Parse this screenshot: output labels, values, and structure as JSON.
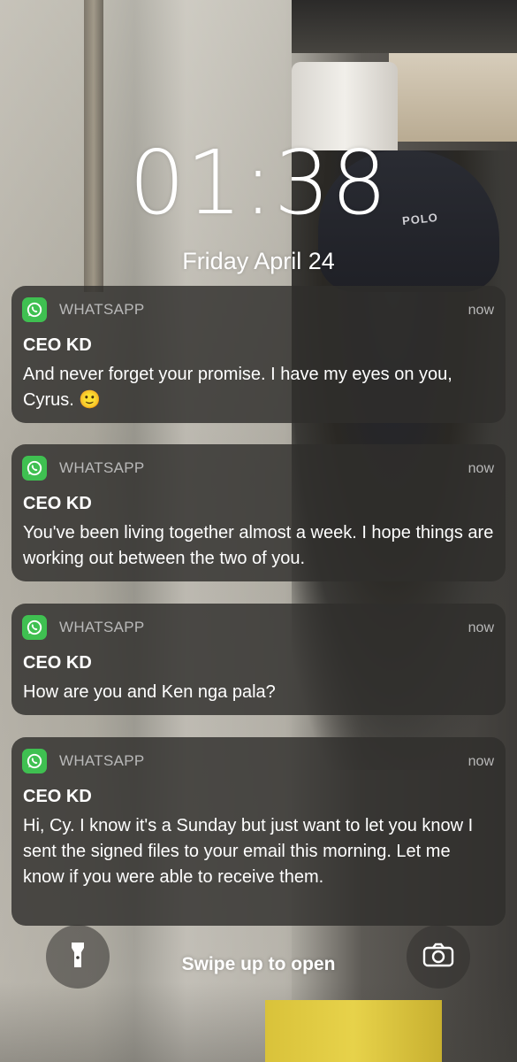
{
  "lockscreen": {
    "time": "01:38",
    "date": "Friday April 24",
    "swipe_hint": "Swipe up to open"
  },
  "wallpaper": {
    "cap_text": "POLO"
  },
  "notifications": [
    {
      "app": "WHATSAPP",
      "time": "now",
      "sender": "CEO KD",
      "message": "And never forget your promise. I have my eyes on you, Cyrus. 🙂"
    },
    {
      "app": "WHATSAPP",
      "time": "now",
      "sender": "CEO KD",
      "message": "You've been living together almost a week. I hope things are working out between the two of you."
    },
    {
      "app": "WHATSAPP",
      "time": "now",
      "sender": "CEO KD",
      "message": "How are you and Ken nga pala?"
    },
    {
      "app": "WHATSAPP",
      "time": "now",
      "sender": "CEO KD",
      "message": "Hi, Cy. I know it's a Sunday but just want to let you know I sent the signed files to your email this morning. Let me know if you were able to receive them."
    }
  ],
  "buttons": {
    "flashlight_icon": "flashlight-icon",
    "camera_icon": "camera-icon"
  },
  "colors": {
    "whatsapp_green": "#3fc051",
    "notification_bg": "#302e2c"
  }
}
